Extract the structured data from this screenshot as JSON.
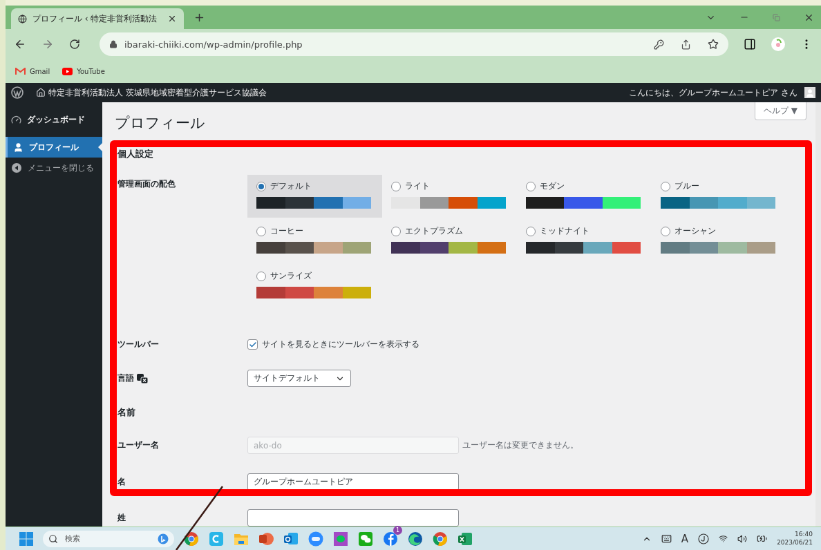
{
  "browser": {
    "tab_title": "プロフィール ‹ 特定非営利活動法",
    "url": "ibaraki-chiiki.com/wp-admin/profile.php",
    "bookmarks": [
      {
        "kind": "gmail",
        "label": "Gmail"
      },
      {
        "kind": "youtube",
        "label": "YouTube"
      }
    ]
  },
  "admin_bar": {
    "site_title": "特定非営利活動法人 茨城県地域密着型介護サービス協議会",
    "greeting": "こんにちは、グループホームユートピア さん"
  },
  "sidebar": {
    "items": [
      {
        "kind": "dashboard",
        "label": "ダッシュボード",
        "selected": false
      },
      {
        "kind": "profile",
        "label": "プロフィール",
        "selected": true
      },
      {
        "kind": "collapse",
        "label": "メニューを閉じる",
        "selected": false
      }
    ]
  },
  "page": {
    "title": "プロフィール",
    "help": "ヘルプ ▼",
    "section_personal": "個人設定",
    "color_scheme_label": "管理画面の配色",
    "color_schemes": [
      {
        "name": "デフォルト",
        "selected": true,
        "swatches": [
          {
            "color": "#1d2327"
          },
          {
            "color": "#2c3338"
          },
          {
            "color": "#2271b1"
          },
          {
            "color": "#72aee6"
          }
        ]
      },
      {
        "name": "ライト",
        "selected": false,
        "swatches": [
          {
            "color": "#e5e5e5"
          },
          {
            "color": "#999999"
          },
          {
            "color": "#d64e07"
          },
          {
            "color": "#04a4cc"
          }
        ]
      },
      {
        "name": "モダン",
        "selected": false,
        "swatches": [
          {
            "color": "#1e1e1e"
          },
          {
            "color": "#3858e9"
          },
          {
            "color": "#33f078"
          }
        ]
      },
      {
        "name": "ブルー",
        "selected": false,
        "swatches": [
          {
            "color": "#096484"
          },
          {
            "color": "#4796b3"
          },
          {
            "color": "#52accc"
          },
          {
            "color": "#74b6ce"
          }
        ]
      },
      {
        "name": "コーヒー",
        "selected": false,
        "swatches": [
          {
            "color": "#46403c"
          },
          {
            "color": "#59524c"
          },
          {
            "color": "#c7a589"
          },
          {
            "color": "#9ea476"
          }
        ]
      },
      {
        "name": "エクトプラズム",
        "selected": false,
        "swatches": [
          {
            "color": "#413256"
          },
          {
            "color": "#523f6d"
          },
          {
            "color": "#a3b745"
          },
          {
            "color": "#d46f15"
          }
        ]
      },
      {
        "name": "ミッドナイト",
        "selected": false,
        "swatches": [
          {
            "color": "#25282b"
          },
          {
            "color": "#363b3f"
          },
          {
            "color": "#69a8bb"
          },
          {
            "color": "#e14d43"
          }
        ]
      },
      {
        "name": "オーシャン",
        "selected": false,
        "swatches": [
          {
            "color": "#627c83"
          },
          {
            "color": "#738e96"
          },
          {
            "color": "#9ebaa0"
          },
          {
            "color": "#aa9d88"
          }
        ]
      },
      {
        "name": "サンライズ",
        "selected": false,
        "swatches": [
          {
            "color": "#b43c38"
          },
          {
            "color": "#cf4944"
          },
          {
            "color": "#dd823b"
          },
          {
            "color": "#ccaf0b"
          }
        ]
      }
    ],
    "toolbar_label": "ツールバー",
    "toolbar_option": {
      "label": "サイトを見るときにツールバーを表示する",
      "checked": true
    },
    "language_label": "言語",
    "language_value": "サイトデフォルト",
    "section_name": "名前",
    "username_label": "ユーザー名",
    "username_value": "ako-do",
    "username_note": "ユーザー名は変更できません。",
    "first_name_label": "名",
    "first_name_value": "グループホームユートピア",
    "last_name_label": "姓"
  },
  "taskbar": {
    "search_placeholder": "検索",
    "notification_badge": "1",
    "input_mode": "A",
    "time": "16:40",
    "date": "2023/06/21"
  }
}
